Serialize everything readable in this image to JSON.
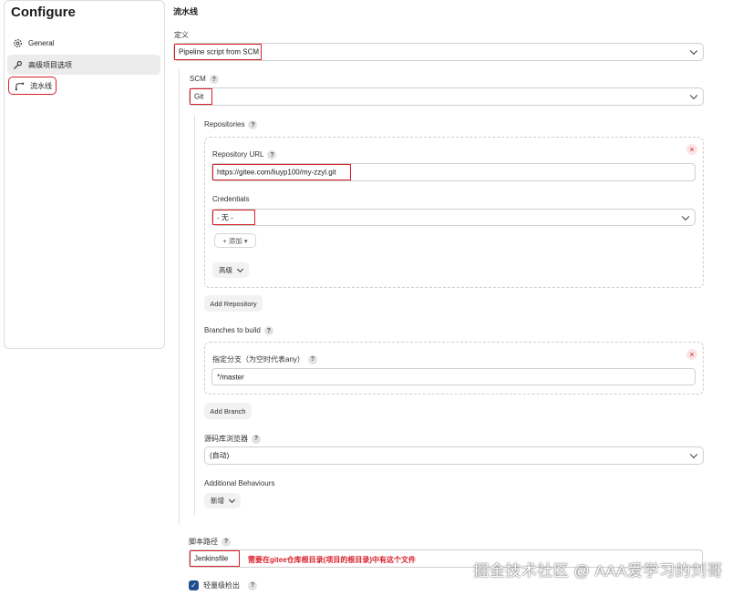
{
  "sidebar": {
    "title": "Configure",
    "items": [
      {
        "label": "General",
        "icon": "gear-icon"
      },
      {
        "label": "高级项目选项",
        "icon": "wrench-icon"
      },
      {
        "label": "流水线",
        "icon": "pipeline-icon"
      }
    ]
  },
  "main": {
    "section_title": "流水线",
    "definition": {
      "label": "定义",
      "value": "Pipeline script from SCM"
    },
    "scm": {
      "label": "SCM",
      "value": "Git"
    },
    "repositories": {
      "label": "Repositories",
      "repo_url_label": "Repository URL",
      "repo_url_value": "https://gitee.com/liuyp100/my-zzyl.git",
      "credentials_label": "Credentials",
      "credentials_value": "- 无 -",
      "add_credentials_label": "+ 添加 ▾",
      "advanced_label": "高级",
      "add_repository_label": "Add Repository"
    },
    "branches": {
      "label": "Branches to build",
      "branch_specifier_label": "指定分支（为空时代表any）",
      "branch_specifier_value": "*/master",
      "add_branch_label": "Add Branch"
    },
    "repo_browser": {
      "label": "源码库浏览器",
      "value": "(自动)"
    },
    "additional_behaviours": {
      "label": "Additional Behaviours",
      "add_label": "新增"
    },
    "script_path": {
      "label": "脚本路径",
      "value": "Jenkinsfile",
      "annotation": "需要在gitee仓库根目录(项目的根目录)中有这个文件"
    },
    "lightweight_checkout": {
      "label": "轻量级检出",
      "checked": true
    }
  },
  "watermark": "掘金技术社区 @ AAA爱学习的刘哥",
  "colors": {
    "highlight": "#d9202a",
    "checkbox": "#1f4f8f"
  }
}
